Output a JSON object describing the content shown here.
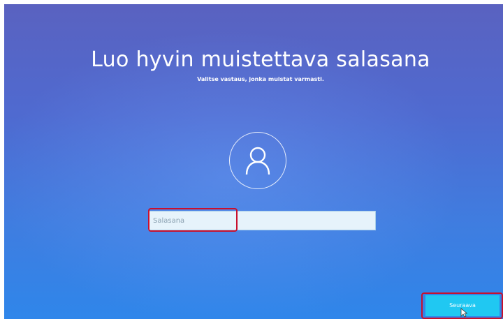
{
  "setup": {
    "title": "Luo hyvin muistettava salasana",
    "subtitle": "Valitse vastaus, jonka muistat varmasti.",
    "password_placeholder": "Salasana",
    "password_value": "",
    "next_label": "Seuraava"
  },
  "icons": {
    "avatar": "user-icon",
    "cursor": "mouse-pointer-icon"
  },
  "colors": {
    "background_top": "#5a62c0",
    "background_bottom": "#2f86ea",
    "next_button": "#20c8f2",
    "highlight": "#c8102e",
    "field_background": "#e6f3fb"
  }
}
